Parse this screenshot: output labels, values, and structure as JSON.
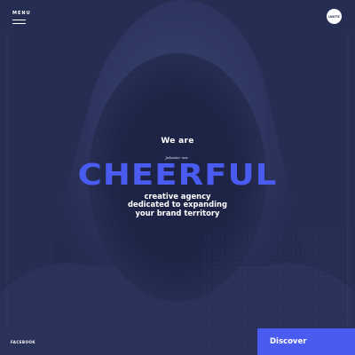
{
  "header": {
    "menu_label": "MENU",
    "logo_text": "UNITE"
  },
  "hero": {
    "intro": "We are",
    "highlight": "CHEERFUL",
    "tag": "Joboster nos",
    "subline_1": "creative agency",
    "subline_2": "dedicated to expanding",
    "subline_3": "your brand territory"
  },
  "footer": {
    "social_link": "FACEBOOK",
    "cta_label": "Discover"
  },
  "colors": {
    "background": "#252d52",
    "accent": "#4a5cf0",
    "text": "#ffffff"
  },
  "icons": {
    "menu": "hamburger-icon"
  }
}
